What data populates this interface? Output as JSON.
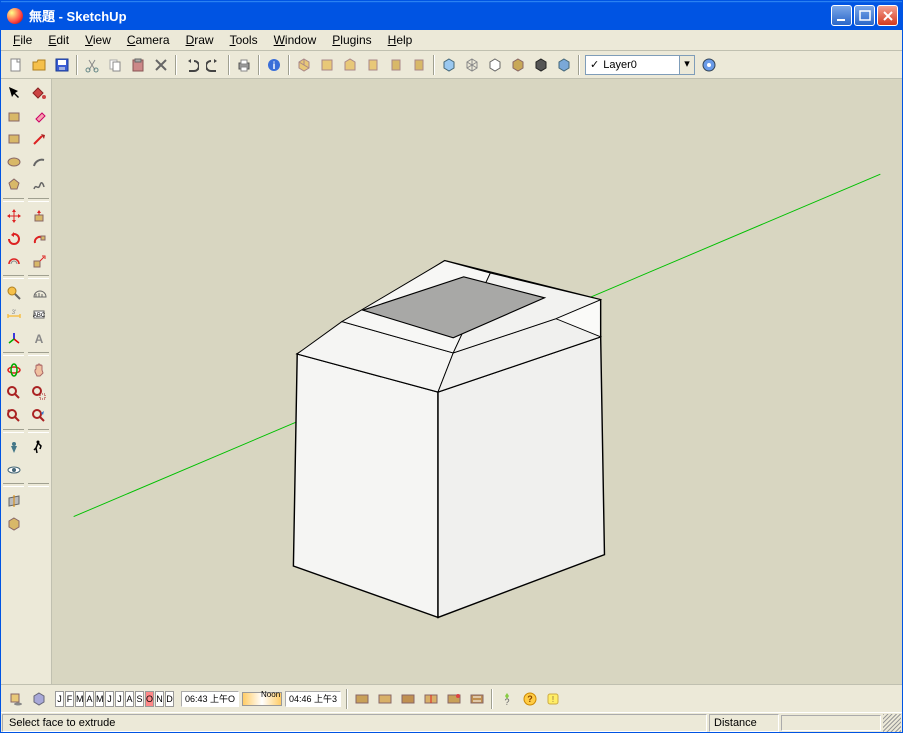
{
  "window": {
    "title": "無題 - SketchUp"
  },
  "menu": [
    {
      "label": "File",
      "u": "F"
    },
    {
      "label": "Edit",
      "u": "E"
    },
    {
      "label": "View",
      "u": "V"
    },
    {
      "label": "Camera",
      "u": "C"
    },
    {
      "label": "Draw",
      "u": "D"
    },
    {
      "label": "Tools",
      "u": "T"
    },
    {
      "label": "Window",
      "u": "W"
    },
    {
      "label": "Plugins",
      "u": "P"
    },
    {
      "label": "Help",
      "u": "H"
    }
  ],
  "toolbar_top": {
    "layer_selected": "Layer0"
  },
  "timeline": {
    "months": [
      "J",
      "F",
      "M",
      "A",
      "M",
      "J",
      "J",
      "A",
      "S",
      "O",
      "N",
      "D"
    ],
    "time_left": "06:43 上午O",
    "mid": "Noon",
    "time_right": "04:46 上午3"
  },
  "status": {
    "hint": "Select face to extrude",
    "distance_label": "Distance"
  }
}
